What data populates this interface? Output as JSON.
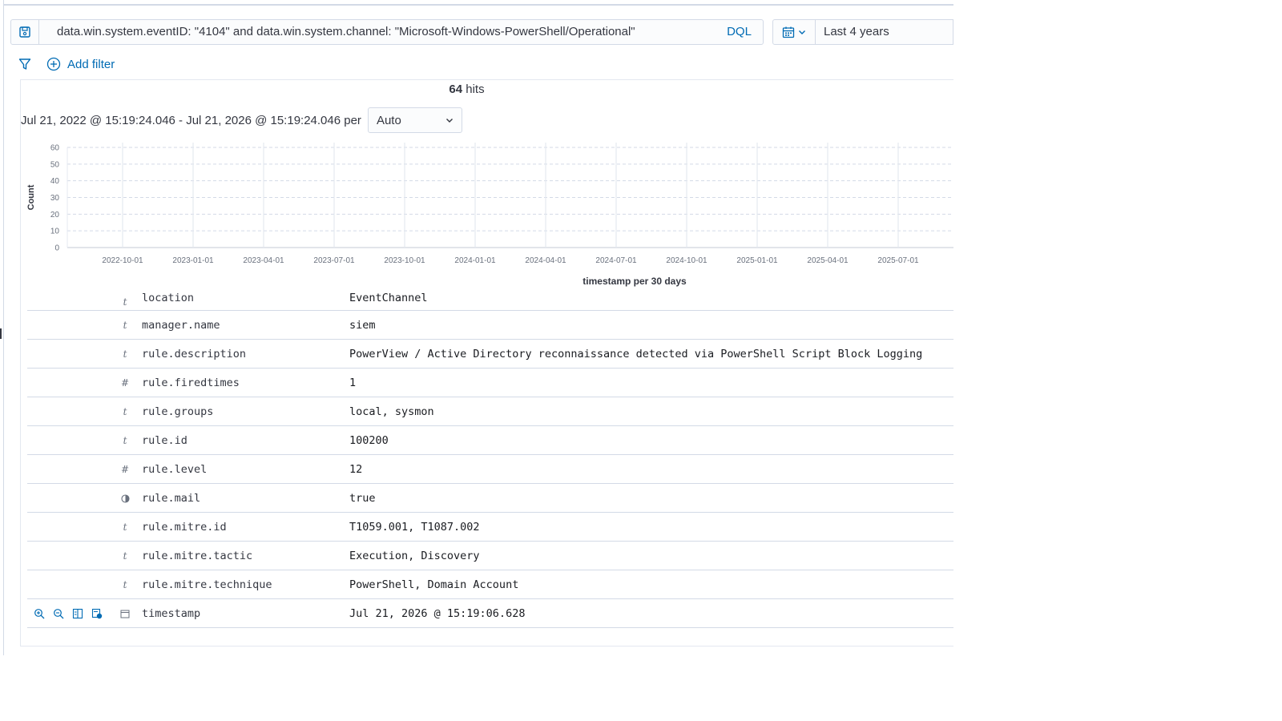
{
  "query": {
    "text": "data.win.system.eventID: \"4104\" and data.win.system.channel: \"Microsoft-Windows-PowerShell/Operational\"",
    "language_label": "DQL",
    "date_range_label": "Last 4 years"
  },
  "filters": {
    "add_filter_label": "Add filter"
  },
  "hits": {
    "count": "64",
    "label": "hits"
  },
  "interval": {
    "range_text": "Jul 21, 2022 @ 15:19:24.046 - Jul 21, 2026 @ 15:19:24.046 per",
    "selected": "Auto"
  },
  "chart_data": {
    "type": "bar",
    "ylabel": "Count",
    "xlabel": "timestamp per 30 days",
    "ylim": [
      0,
      60
    ],
    "yticks": [
      0,
      10,
      20,
      30,
      40,
      50,
      60
    ],
    "x_ticks": [
      "2022-10-01",
      "2023-01-01",
      "2023-04-01",
      "2023-07-01",
      "2023-10-01",
      "2024-01-01",
      "2024-04-01",
      "2024-07-01",
      "2024-10-01",
      "2025-01-01",
      "2025-04-01",
      "2025-07-01"
    ],
    "grid": true,
    "values": []
  },
  "doc_fields": [
    {
      "type": "t",
      "field": "location",
      "value": "EventChannel"
    },
    {
      "type": "t",
      "field": "manager.name",
      "value": "siem"
    },
    {
      "type": "t",
      "field": "rule.description",
      "value": "PowerView / Active Directory reconnaissance detected via PowerShell Script Block Logging"
    },
    {
      "type": "#",
      "field": "rule.firedtimes",
      "value": "1"
    },
    {
      "type": "t",
      "field": "rule.groups",
      "value": "local, sysmon"
    },
    {
      "type": "t",
      "field": "rule.id",
      "value": "100200"
    },
    {
      "type": "#",
      "field": "rule.level",
      "value": "12"
    },
    {
      "type": "bool",
      "field": "rule.mail",
      "value": "true"
    },
    {
      "type": "t",
      "field": "rule.mitre.id",
      "value": "T1059.001, T1087.002"
    },
    {
      "type": "t",
      "field": "rule.mitre.tactic",
      "value": "Execution, Discovery"
    },
    {
      "type": "t",
      "field": "rule.mitre.technique",
      "value": "PowerShell, Domain Account"
    },
    {
      "type": "date",
      "field": "timestamp",
      "value": "Jul 21, 2026 @ 15:19:06.628"
    }
  ],
  "row_actions": [
    "zoom-in-icon",
    "zoom-out-icon",
    "toggle-column-icon",
    "filter-exists-icon"
  ],
  "colors": {
    "accent": "#006bb4",
    "text": "#343741",
    "border": "#d3dae6"
  }
}
